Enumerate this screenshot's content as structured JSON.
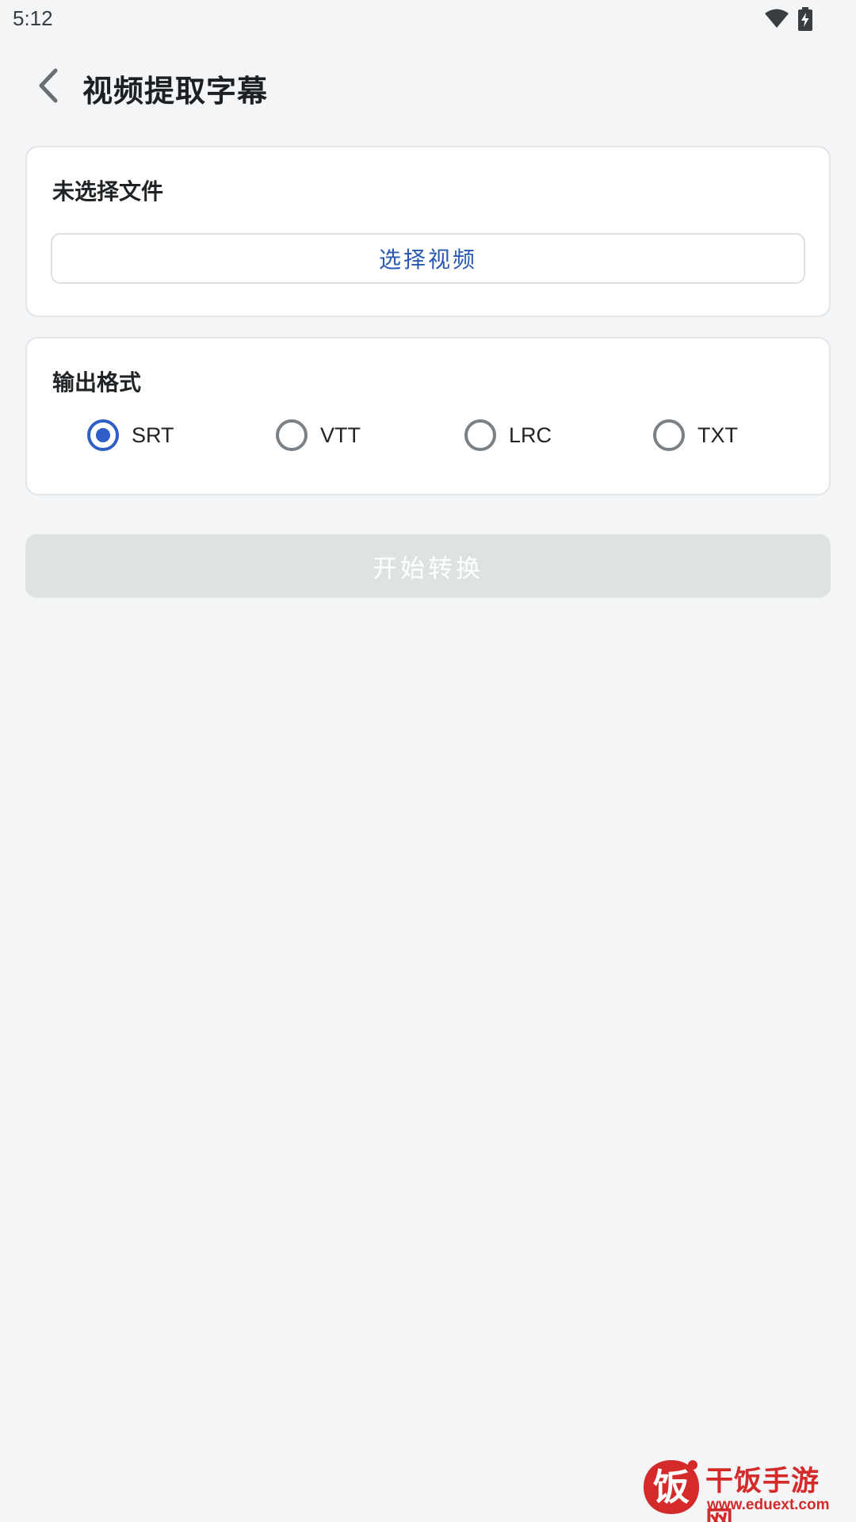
{
  "status_bar": {
    "time": "5:12",
    "wifi_icon": "wifi-icon",
    "battery_icon": "battery-charging-icon"
  },
  "app_bar": {
    "back_icon": "chevron-left-icon",
    "title": "视频提取字幕"
  },
  "file_card": {
    "status_text": "未选择文件",
    "select_button_label": "选择视频"
  },
  "format_card": {
    "title": "输出格式",
    "options": [
      {
        "label": "SRT",
        "checked": true
      },
      {
        "label": "VTT",
        "checked": false
      },
      {
        "label": "LRC",
        "checked": false
      },
      {
        "label": "TXT",
        "checked": false
      }
    ]
  },
  "start_button": {
    "label": "开始转换",
    "enabled": false
  },
  "watermark": {
    "logo_char": "饭",
    "name": "干饭手游网",
    "url": "www.eduext.com"
  },
  "colors": {
    "background": "#f3f5f7",
    "accent": "#2f5fc6",
    "link": "#2a59b0",
    "disabled_button": "#dde3e3",
    "watermark": "#d42a2a"
  }
}
